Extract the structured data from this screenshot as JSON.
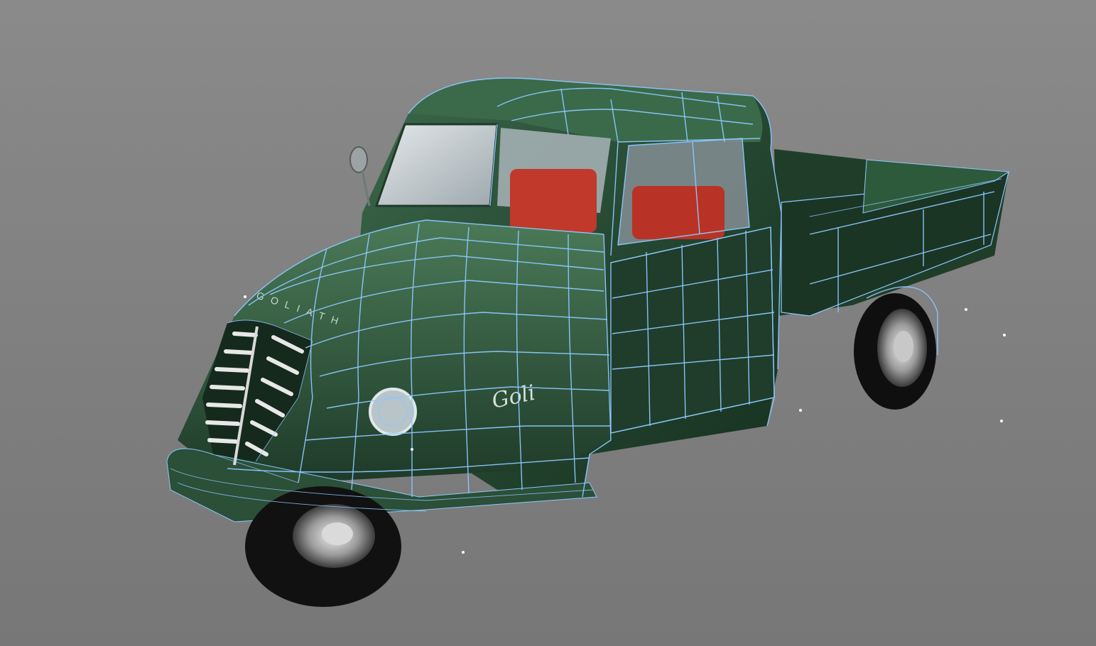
{
  "viewport": {
    "background": "#7e7e7e",
    "wireframe_color": "#8cc8ff",
    "body_color": "#274a33",
    "seat_color": "#c0392b"
  },
  "model": {
    "hood_lettering": "GOLIATH",
    "side_script": "Goli"
  }
}
